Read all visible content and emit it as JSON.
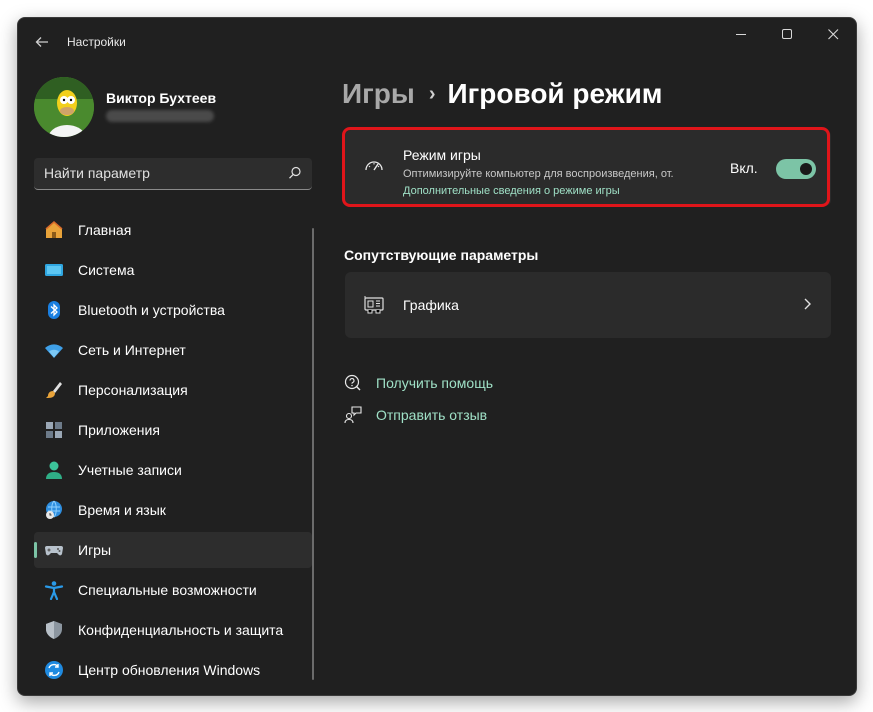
{
  "window": {
    "title": "Настройки"
  },
  "profile": {
    "name": "Виктор Бухтеев"
  },
  "search": {
    "placeholder": "Найти параметр"
  },
  "nav": {
    "items": [
      {
        "label": "Главная",
        "icon": "home-icon"
      },
      {
        "label": "Система",
        "icon": "monitor-icon"
      },
      {
        "label": "Bluetooth и устройства",
        "icon": "bluetooth-icon"
      },
      {
        "label": "Сеть и Интернет",
        "icon": "wifi-icon"
      },
      {
        "label": "Персонализация",
        "icon": "brush-icon"
      },
      {
        "label": "Приложения",
        "icon": "apps-icon"
      },
      {
        "label": "Учетные записи",
        "icon": "person-icon"
      },
      {
        "label": "Время и язык",
        "icon": "globe-clock-icon"
      },
      {
        "label": "Игры",
        "icon": "gamepad-icon",
        "active": true
      },
      {
        "label": "Специальные возможности",
        "icon": "accessibility-icon"
      },
      {
        "label": "Конфиденциальность и защита",
        "icon": "shield-icon"
      },
      {
        "label": "Центр обновления Windows",
        "icon": "update-icon"
      }
    ]
  },
  "breadcrumb": {
    "parent": "Игры",
    "separator": "›",
    "current": "Игровой режим"
  },
  "game_mode": {
    "title": "Режим игры",
    "description": "Оптимизируйте компьютер для воспроизведения, от...",
    "link": "Дополнительные сведения о режиме игры",
    "state": "Вкл.",
    "enabled": true
  },
  "related": {
    "title": "Сопутствующие параметры",
    "items": [
      {
        "label": "Графика",
        "icon": "graphics-card-icon"
      }
    ]
  },
  "help": {
    "get_help": "Получить помощь",
    "feedback": "Отправить отзыв"
  },
  "colors": {
    "accent": "#7cc4a6",
    "highlight": "#e0151a",
    "background": "#202020",
    "card": "#2b2b2b"
  }
}
